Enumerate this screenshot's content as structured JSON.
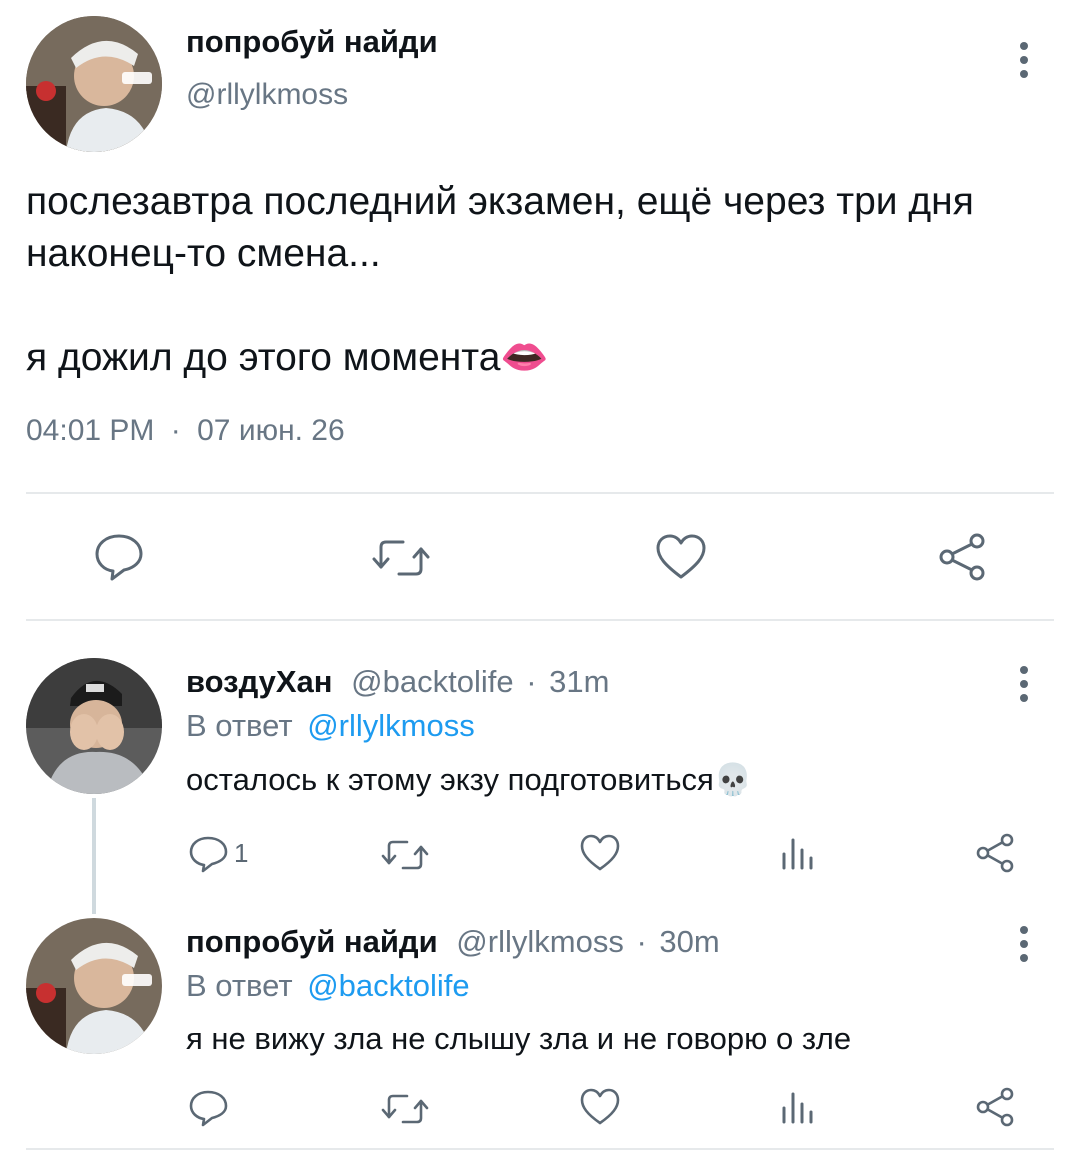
{
  "main_tweet": {
    "display_name": "попробуй найди",
    "handle": "@rllylkmoss",
    "text_line1": "послезавтра последний экзамен, ещё через три дня",
    "text_line2": "наконец-то смена...",
    "text_line3": "я дожил до этого момента",
    "emoji": "👄",
    "time": "04:01 PM",
    "separator": "·",
    "date": "07 июн. 26"
  },
  "replies": [
    {
      "display_name": "воздуХан",
      "handle": "@backtolife",
      "sep": "·",
      "age": "31m",
      "reply_prefix": "В ответ",
      "reply_to": "@rllylkmoss",
      "text": "осталось к этому экзу подготовиться",
      "emoji": "💀",
      "reply_count": "1"
    },
    {
      "display_name": "попробуй найди",
      "handle": "@rllylkmoss",
      "sep": "·",
      "age": "30m",
      "reply_prefix": "В ответ",
      "reply_to": "@backtolife",
      "text": "я не вижу зла не слышу зла и не говорю о зле",
      "reply_count": ""
    }
  ],
  "colors": {
    "icon": "#5b6874",
    "link": "#1d9bf0",
    "muted": "#687684"
  },
  "icons": [
    "reply-icon",
    "retweet-icon",
    "like-icon",
    "share-icon",
    "views-icon",
    "more-icon"
  ]
}
